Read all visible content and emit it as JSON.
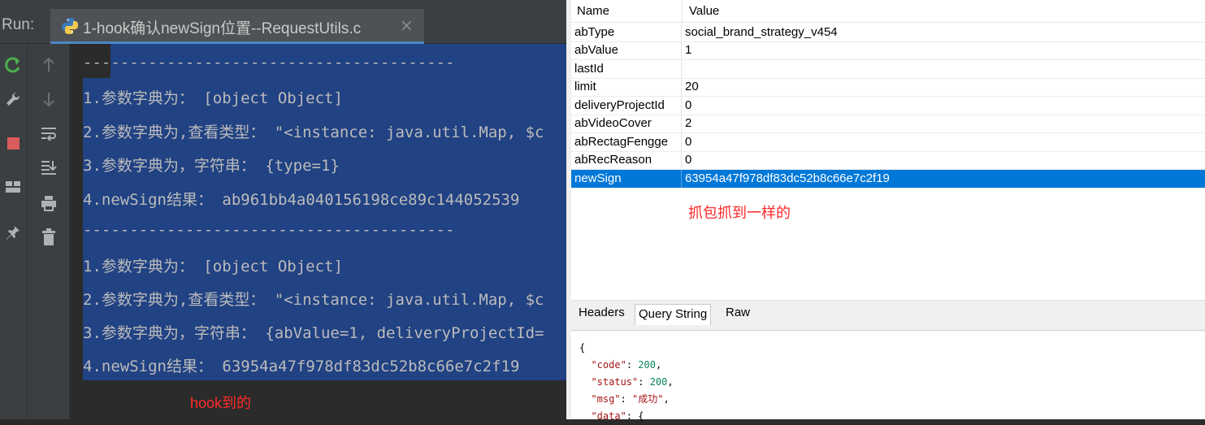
{
  "ide": {
    "run_label": "Run:",
    "tab_title": "1-hook确认newSign位置--RequestUtils.c",
    "tab_close": "×",
    "console_lines": [
      "----------------------------------------",
      "1.参数字典为： [object Object]",
      "2.参数字典为,查看类型： \"<instance: java.util.Map, $c",
      "3.参数字典为，字符串： {type=1}",
      "4.newSign结果： ab961bb4a040156198ce89c144052539",
      "----------------------------------------",
      "1.参数字典为： [object Object]",
      "2.参数字典为,查看类型： \"<instance: java.util.Map, $c",
      "3.参数字典为，字符串： {abValue=1, deliveryProjectId=",
      "4.newSign结果： 63954a47f978df83dc52b8c66e7c2f19"
    ],
    "annotation": "hook到的"
  },
  "inspector": {
    "columns": {
      "name": "Name",
      "value": "Value"
    },
    "rows": [
      {
        "name": "abType",
        "value": "social_brand_strategy_v454"
      },
      {
        "name": "abValue",
        "value": "1"
      },
      {
        "name": "lastId",
        "value": ""
      },
      {
        "name": "limit",
        "value": "20"
      },
      {
        "name": "deliveryProjectId",
        "value": "0"
      },
      {
        "name": "abVideoCover",
        "value": "2"
      },
      {
        "name": "abRectagFengge",
        "value": "0"
      },
      {
        "name": "abRecReason",
        "value": "0"
      },
      {
        "name": "newSign",
        "value": "63954a47f978df83dc52b8c66e7c2f19"
      }
    ],
    "selected_row": "newSign",
    "annotation": "抓包抓到一样的",
    "tabs": [
      "Headers",
      "Query String",
      "Raw"
    ],
    "active_tab": "Query String",
    "response": {
      "open_brace": "{",
      "code_key": "\"code\"",
      "code_val": "200",
      "status_key": "\"status\"",
      "status_val": "200",
      "msg_key": "\"msg\"",
      "msg_val": "\"成功\"",
      "data_key": "\"data\"",
      "data_val": "{"
    }
  },
  "colors": {
    "selection": "#214283",
    "row_selected": "#0078d7",
    "annotation_red": "#ff2a2a"
  }
}
